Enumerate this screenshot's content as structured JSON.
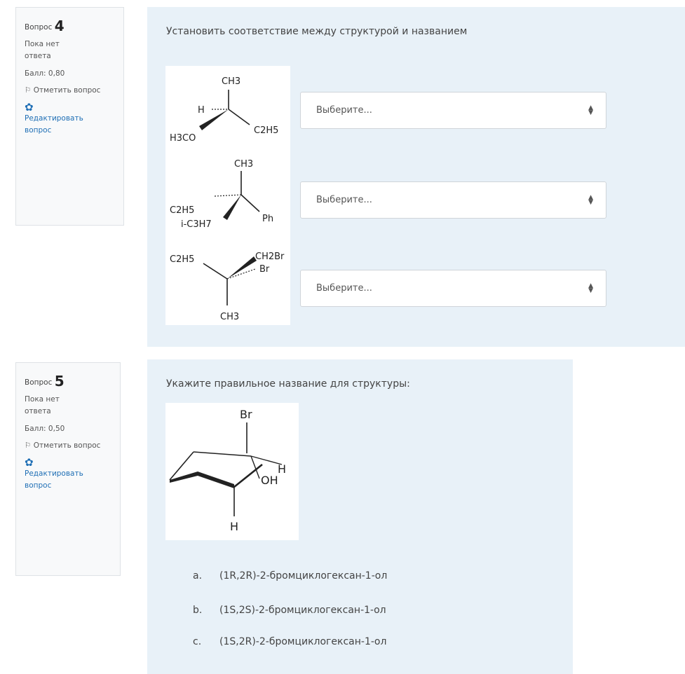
{
  "q4": {
    "label": "Вопрос",
    "number": "4",
    "state": "Пока нет ответа",
    "grade": "Балл: 0,80",
    "flag": "Отметить вопрос",
    "edit": "Редактировать вопрос",
    "text": "Установить соответствие между структурой и названием",
    "select_placeholder": "Выберите...",
    "structures": [
      {
        "atoms": [
          "CH3",
          "H",
          "H3CO",
          "C2H5"
        ]
      },
      {
        "atoms": [
          "CH3",
          "C2H5",
          "i-C3H7",
          "Ph"
        ]
      },
      {
        "atoms": [
          "C2H5",
          "CH2Br",
          "Br",
          "CH3"
        ]
      }
    ]
  },
  "q5": {
    "label": "Вопрос",
    "number": "5",
    "state": "Пока нет ответа",
    "grade": "Балл: 0,50",
    "flag": "Отметить вопрос",
    "edit": "Редактировать вопрос",
    "text": "Укажите правильное название для структуры:",
    "structure_atoms": [
      "Br",
      "H",
      "OH",
      "H"
    ],
    "answers": [
      {
        "letter": "a.",
        "text": "(1R,2R)-2-бромциклогексан-1-ол"
      },
      {
        "letter": "b.",
        "text": "(1S,2S)-2-бромциклогексан-1-ол"
      },
      {
        "letter": "c.",
        "text": "(1S,2R)-2-бромциклогексан-1-ол"
      }
    ]
  }
}
